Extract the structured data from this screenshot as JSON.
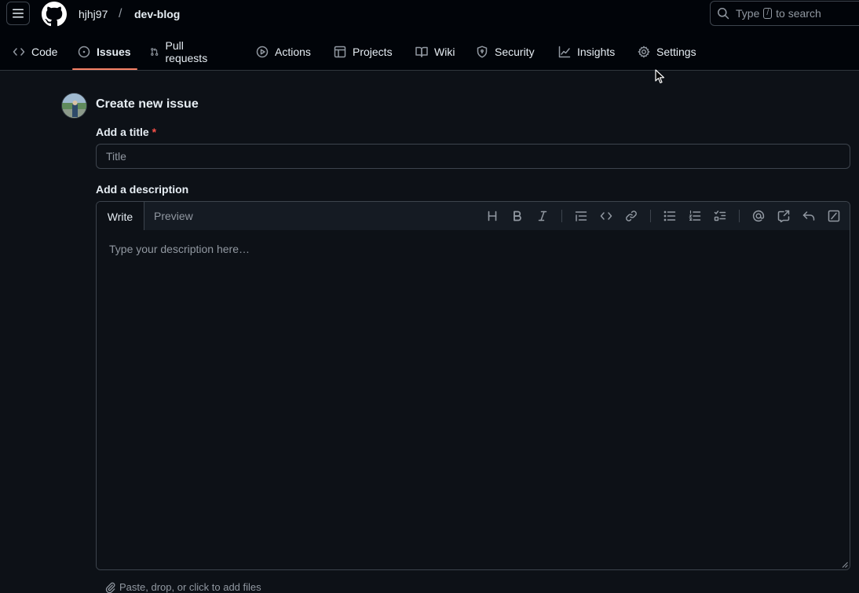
{
  "header": {
    "owner": "hjhj97",
    "separator": "/",
    "repo": "dev-blog",
    "search_type": "Type",
    "search_key": "/",
    "search_suffix": "to search"
  },
  "nav": {
    "tabs": [
      {
        "label": "Code",
        "icon": "code-icon"
      },
      {
        "label": "Issues",
        "icon": "issue-opened-icon",
        "active": true
      },
      {
        "label": "Pull requests",
        "icon": "git-pull-request-icon"
      },
      {
        "label": "Actions",
        "icon": "play-icon"
      },
      {
        "label": "Projects",
        "icon": "table-icon"
      },
      {
        "label": "Wiki",
        "icon": "book-icon"
      },
      {
        "label": "Security",
        "icon": "shield-icon"
      },
      {
        "label": "Insights",
        "icon": "graph-icon"
      },
      {
        "label": "Settings",
        "icon": "gear-icon"
      }
    ]
  },
  "form": {
    "heading": "Create new issue",
    "title_label": "Add a title",
    "required_mark": "*",
    "title_placeholder": "Title",
    "title_value": "",
    "description_label": "Add a description",
    "write_tab": "Write",
    "preview_tab": "Preview",
    "description_placeholder": "Type your description here…",
    "description_value": "",
    "attach_text": "Paste, drop, or click to add files"
  },
  "toolbar": [
    "heading-icon",
    "bold-icon",
    "italic-icon",
    "quote-icon",
    "code-icon",
    "link-icon",
    "unordered-list-icon",
    "ordered-list-icon",
    "task-list-icon",
    "mention-icon",
    "reference-icon",
    "reply-icon",
    "slash-command-icon"
  ],
  "colors": {
    "background": "#0d1117",
    "header": "#010409",
    "active_underline": "#f78166",
    "required": "#f85149",
    "muted": "#9198a1"
  }
}
